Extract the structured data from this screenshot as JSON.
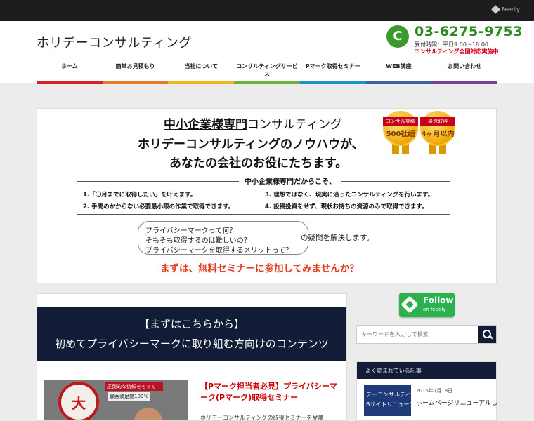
{
  "topbar": {
    "feedly_label": "Feedly"
  },
  "header": {
    "site_title": "ホリデーコンサルティング",
    "phone": {
      "icon": "phone-icon",
      "number": "03-6275-9753",
      "hours": "受付時間：平日9:00～18:00",
      "area": "コンサルティング全国対応実施中"
    }
  },
  "nav": {
    "items": [
      {
        "label": "ホーム"
      },
      {
        "label": "簡単お見積もり"
      },
      {
        "label": "当社について"
      },
      {
        "label": "コンサルティングサービス"
      },
      {
        "label": "Pマーク取得セミナー"
      },
      {
        "label": "WEB講座"
      },
      {
        "label": "お問い合わせ"
      }
    ],
    "bar_colors": [
      "#d9202a",
      "#e9792a",
      "#f2b61c",
      "#6cb33e",
      "#1a93c8",
      "#3f5fa8",
      "#7a3f96"
    ]
  },
  "banner": {
    "line1_highlight": "中小企業様専門",
    "line1_rest": "コンサルティング",
    "line2": "ホリデーコンサルティングのノウハウが、",
    "line3": "あなたの会社のお役にたちます。",
    "medals": [
      {
        "top": "コンサル実績",
        "bottom": "500社超"
      },
      {
        "top": "最速取得",
        "bottom": "4ヶ月以内"
      }
    ],
    "box_title": "中小企業様専門だからこそ、",
    "box_items": [
      "1.「〇月までに取得したい」を叶えます。",
      "2. 手間のかからない必要最小限の作業で取得できます。",
      "3. 理想ではなく、現実に沿ったコンサルティングを行います。",
      "4. 設備投資をせず、現状お持ちの資源のみで取得できます。"
    ],
    "questions": [
      "プライバシーマークって何？",
      "そもそも取得するのは難しいの？",
      "プライバシーマークを取得するメリットって？"
    ],
    "after_questions": "の疑問を解決します。",
    "cta": "まずは、無料セミナーに参加してみませんか？"
  },
  "main": {
    "hero_line1": "【まずはこちらから】",
    "hero_line2": "初めてプライバシーマークに取り組む方向けのコンテンツ",
    "thumb_stamp": "大",
    "thumb_text1": "圧倒的な信頼をもって！",
    "thumb_text2": "顧客満足度100%",
    "post_title": "【Pマーク担当者必見】プライバシーマーク(Pマーク)取得セミナー",
    "post_excerpt": "ホリデーコンサルティングの取得セミナーを受講"
  },
  "sidebar": {
    "feedly_follow": "Follow",
    "feedly_on": "on feedly",
    "search_placeholder": "キーワードを入力して検索",
    "widget_title": "よく読まれている記事",
    "widget_thumb_line1": "デーコンサルティ",
    "widget_thumb_line2": "Bサイトリニューア",
    "widget_date": "2016年1月18日",
    "widget_post_title": "ホームページリニューアルし"
  }
}
